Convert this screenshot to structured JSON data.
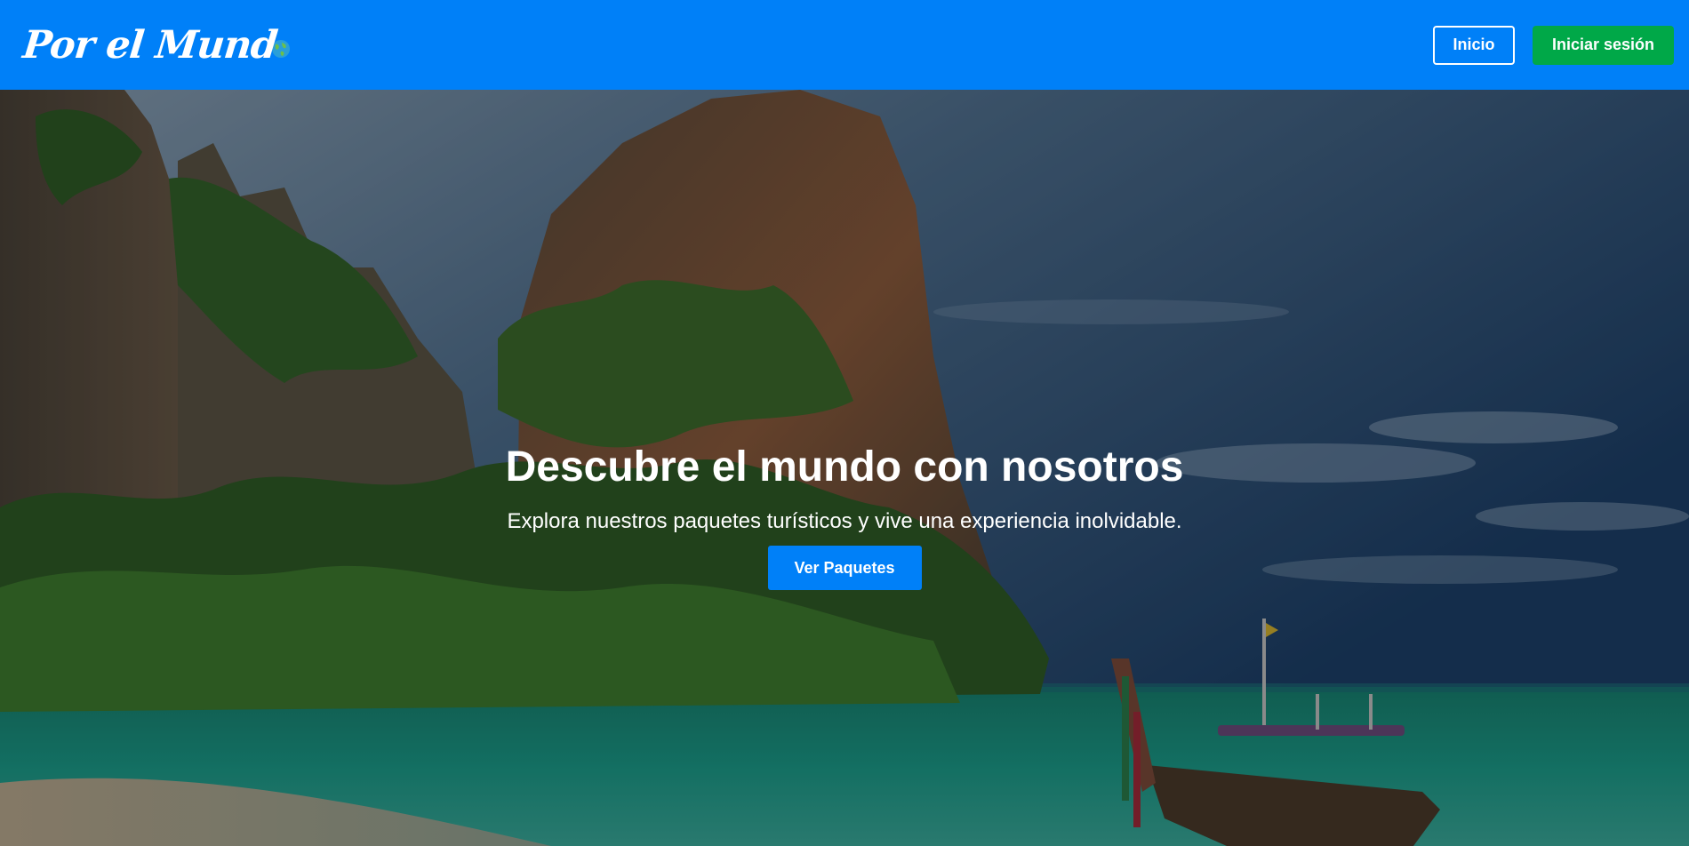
{
  "navbar": {
    "brand": "Por el Mund",
    "brand_icon": "globe-icon",
    "inicio_label": "Inicio",
    "login_label": "Iniciar sesión",
    "colors": {
      "navbar_bg": "#0080f8",
      "login_bg": "#00a848"
    }
  },
  "hero": {
    "title": "Descubre el mundo con nosotros",
    "subtitle": "Explora nuestros paquetes turísticos y vive una experiencia inolvidable.",
    "cta_label": "Ver Paquetes",
    "background_image": "beach-cliffs-longtail-boat-photo",
    "colors": {
      "cta_bg": "#0080f8"
    }
  }
}
